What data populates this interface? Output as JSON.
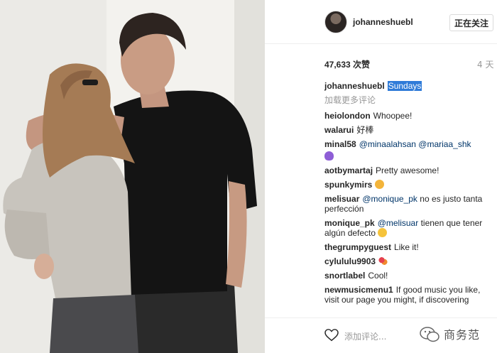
{
  "post": {
    "author": "johanneshuebl",
    "follow_button_label": "正在关注",
    "likes": "47,633 次赞",
    "time_ago": "4 天",
    "caption_user": "johanneshuebl",
    "caption_text": "Sundays",
    "load_more_label": "加载更多评论"
  },
  "comments": [
    {
      "user": "heiolondon",
      "text": "Whoopee!"
    },
    {
      "user": "walarui",
      "text": "好棒"
    },
    {
      "user": "minal58",
      "mention1": "@minaalahsan",
      "mention2": "@mariaa_shk",
      "emoji": "purple-heart-emoji"
    },
    {
      "user": "aotbymartaj",
      "text": "Pretty awesome!"
    },
    {
      "user": "spunkymirs",
      "emoji": "ok-hand-emoji"
    },
    {
      "user": "melisuar",
      "mention": "@monique_pk",
      "text": "no es justo tanta perfección"
    },
    {
      "user": "monique_pk",
      "mention": "@melisuar",
      "text": "tienen que tener algún defecto",
      "emoji": "thinking-face-emoji"
    },
    {
      "user": "thegrumpyguest",
      "text": "Like it!"
    },
    {
      "user": "cylululu9903",
      "emoji": "hearts-emoji"
    },
    {
      "user": "snortlabel",
      "text": "Cool!"
    },
    {
      "user": "newmusicmenu1",
      "text": "If good music you like, visit our page you might, if discovering"
    }
  ],
  "footer": {
    "add_comment_placeholder": "添加评论...",
    "watermark_text": "商务范"
  },
  "colors": {
    "selection": "#2f7bd8",
    "mention": "#003569",
    "muted": "#999999",
    "border": "#efefef"
  }
}
